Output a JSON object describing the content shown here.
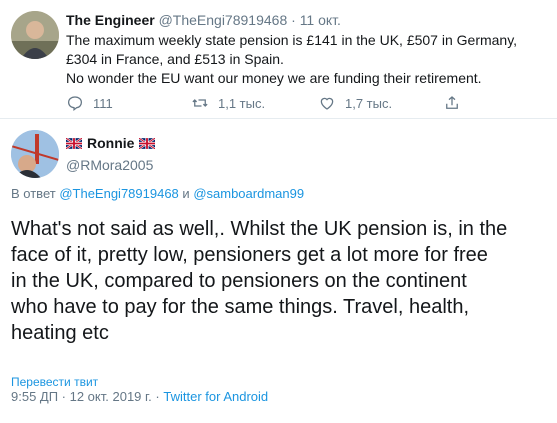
{
  "parent_tweet": {
    "author_name": "The Engineer",
    "handle": "@TheEngi78919468",
    "separator": "·",
    "date": "11 окт.",
    "text_lines": [
      "The maximum weekly state pension is £141 in the UK, £507 in Germany,",
      "£304 in France, and £513 in Spain.",
      "No wonder the EU want our money we are funding their retirement."
    ],
    "reply_count": "111",
    "retweet_count": "1,1 тыс.",
    "like_count": "1,7 тыс."
  },
  "reply_tweet": {
    "author_name": "Ronnie",
    "handle": "@RMora2005",
    "reply_to_prefix": "В ответ",
    "reply_to_user1": "@TheEngi78919468",
    "reply_to_and": "и",
    "reply_to_user2": "@samboardman99",
    "text_lines": [
      "What's not said as well,. Whilst the UK pension is, in the",
      "face of it,  pretty low, pensioners get a lot more for free",
      "in the UK, compared to pensioners on the continent",
      "who have to pay for the same things.  Travel, health,",
      "heating etc"
    ],
    "translate_label": "Перевести твит",
    "timestamp": "9:55 ДП · 12 окт. 2019 г.",
    "meta_separator": "·",
    "source": "Twitter for Android"
  },
  "colors": {
    "text": "#14171a",
    "secondary": "#657786",
    "link": "#1b95e0",
    "divider": "#e6ecf0"
  }
}
